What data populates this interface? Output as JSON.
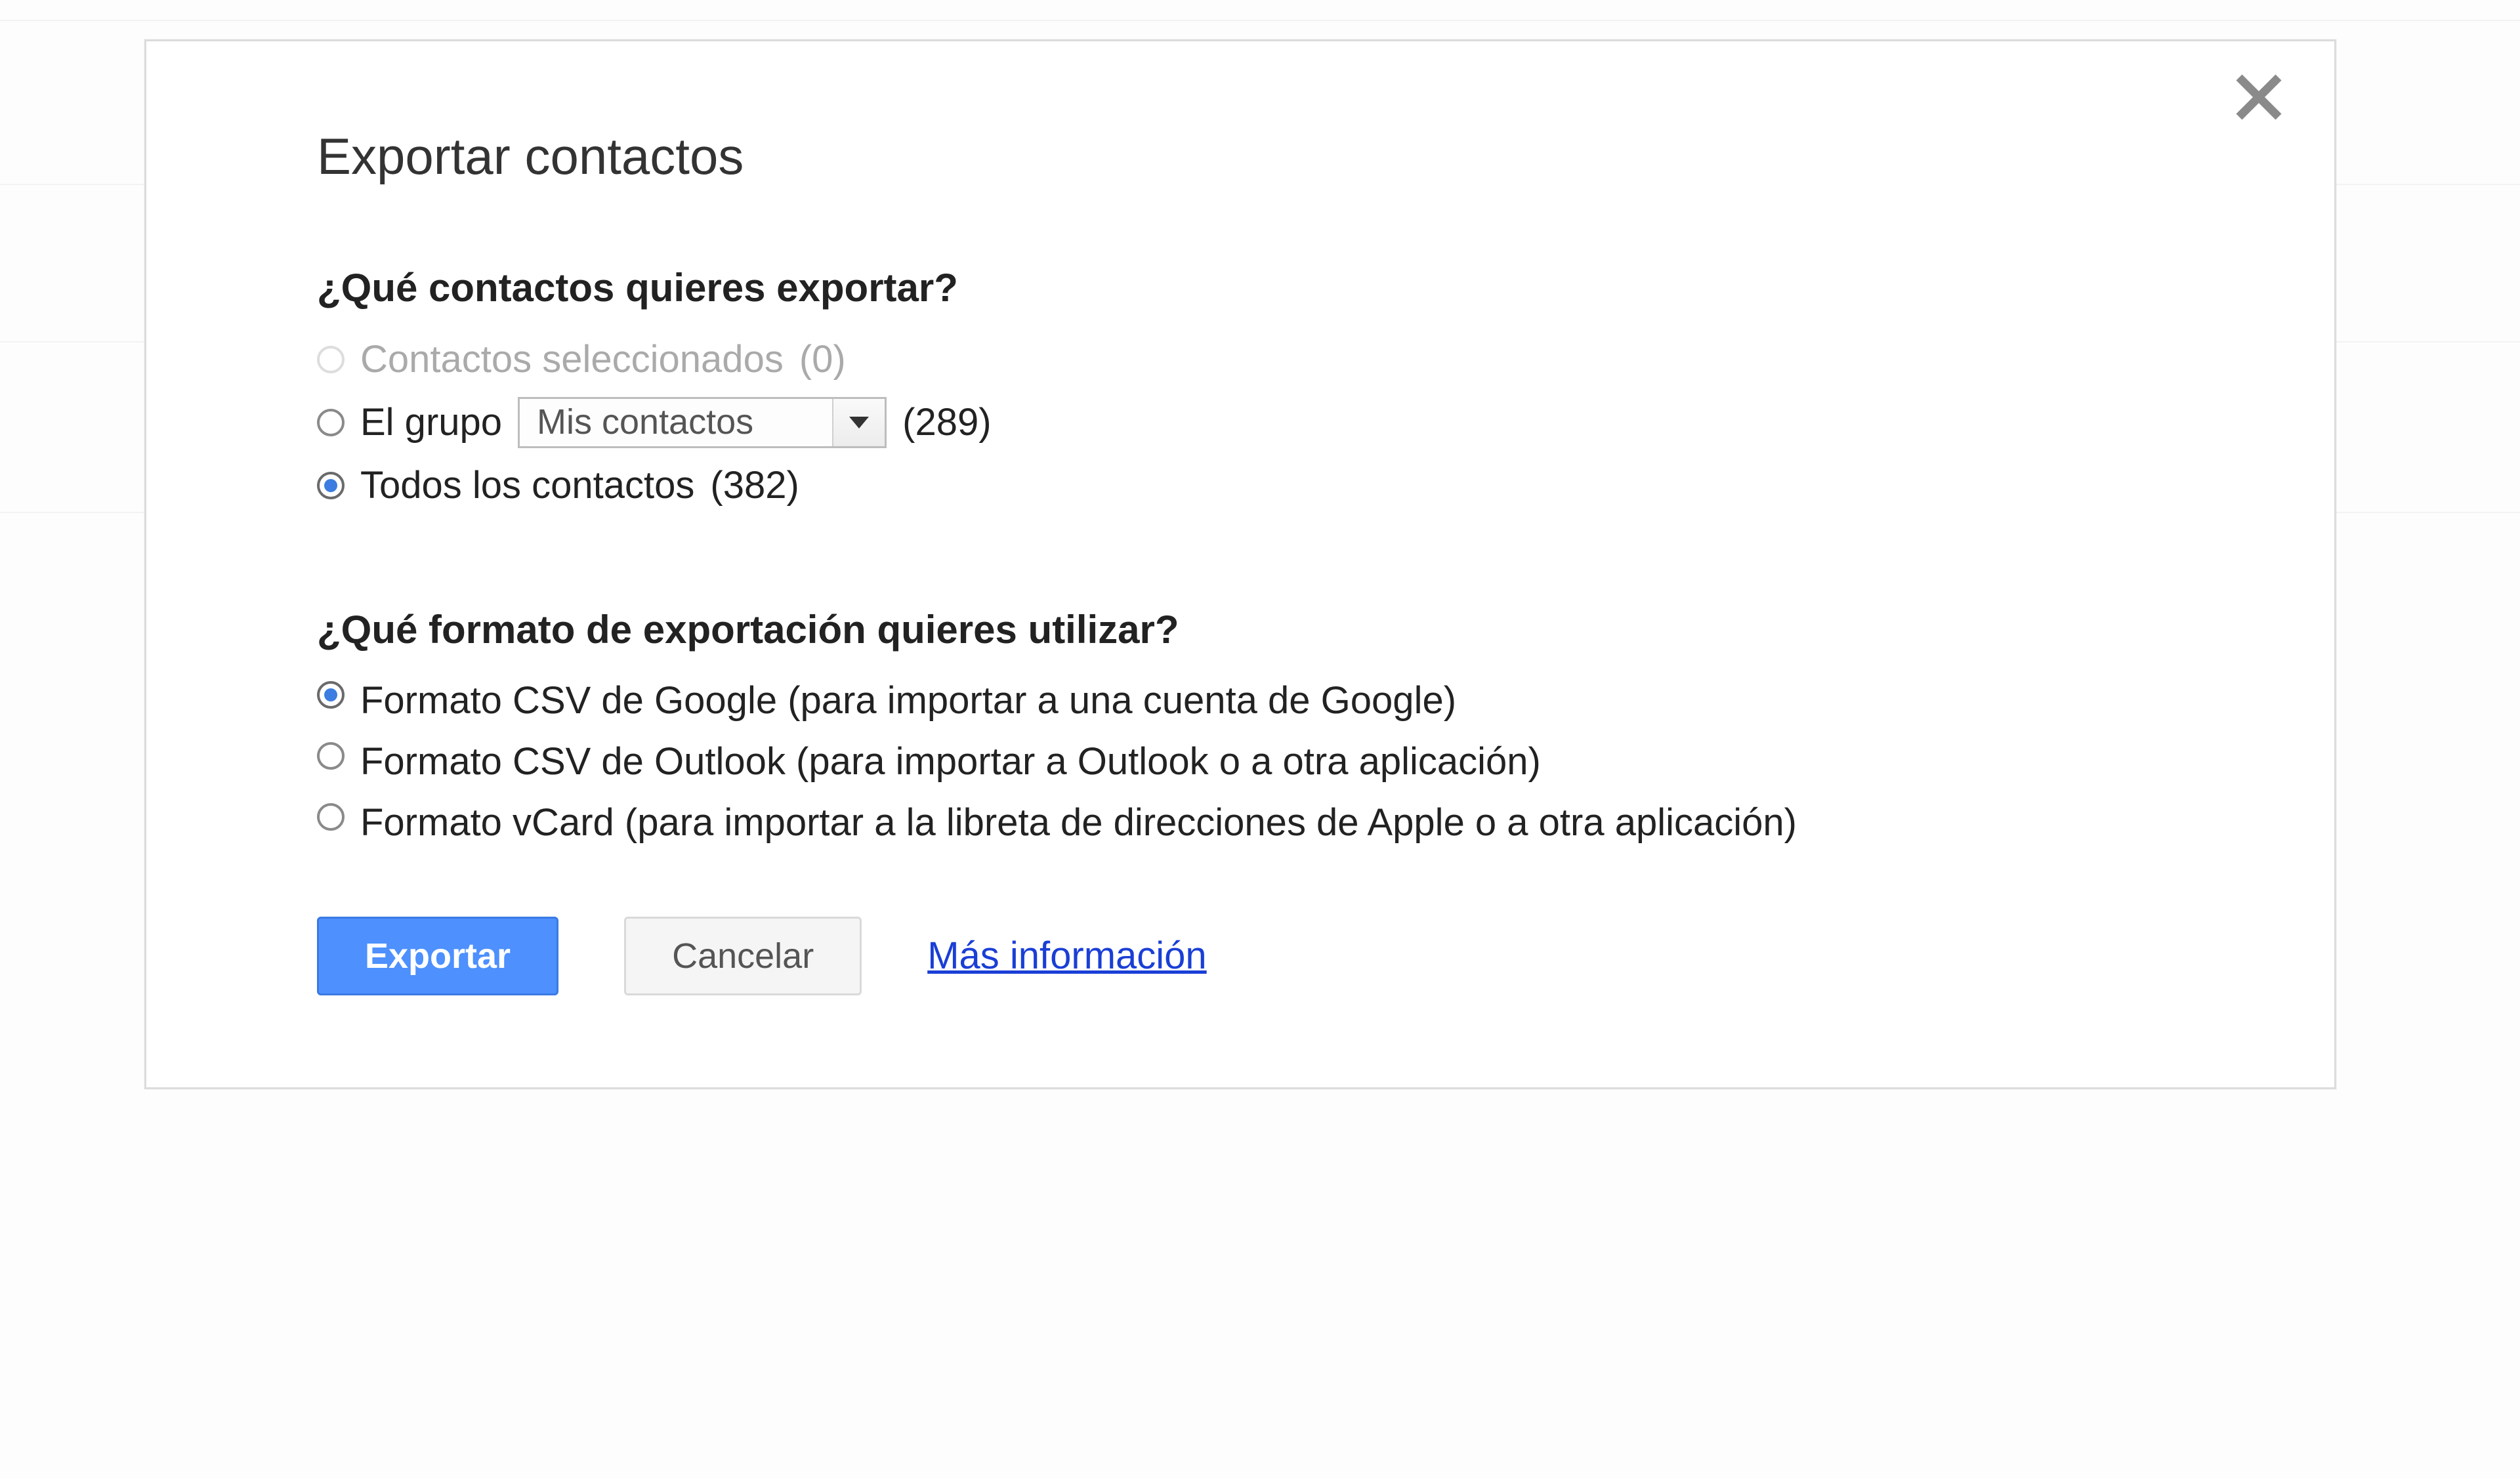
{
  "dialog": {
    "title": "Exportar contactos",
    "section_contacts": {
      "heading": "¿Qué contactos quieres exportar?",
      "option_selected": {
        "label": "Contactos seleccionados",
        "count_text": "(0)"
      },
      "option_group": {
        "label": "El grupo",
        "select_value": "Mis contactos",
        "count_text": "(289)"
      },
      "option_all": {
        "label": "Todos los contactos",
        "count_text": "(382)"
      }
    },
    "section_format": {
      "heading": "¿Qué formato de exportación quieres utilizar?",
      "option_google": "Formato CSV de Google (para importar a una cuenta de Google)",
      "option_outlook": "Formato CSV de Outlook (para importar a Outlook o a otra aplicación)",
      "option_vcard": "Formato vCard (para importar a la libreta de direcciones de Apple o a otra aplicación)"
    },
    "footer": {
      "export_btn": "Exportar",
      "cancel_btn": "Cancelar",
      "more_info": "Más información"
    }
  }
}
